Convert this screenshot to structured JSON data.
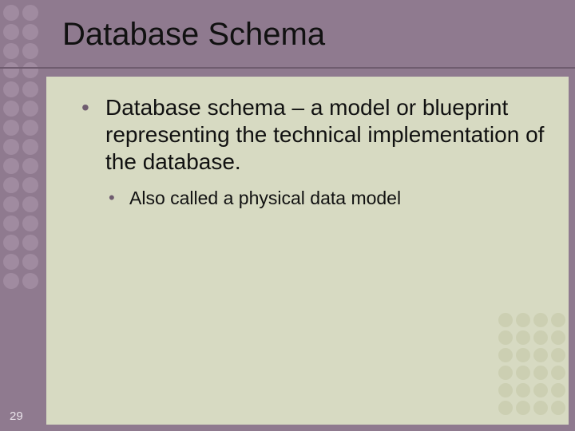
{
  "title": "Database Schema",
  "bullets": {
    "level1": "Database schema – a model or blueprint representing the technical implementation of the database.",
    "level2": "Also called a physical data model"
  },
  "page_number": "29",
  "decor": {
    "left_dot_count": 30,
    "br_dot_count": 24
  }
}
